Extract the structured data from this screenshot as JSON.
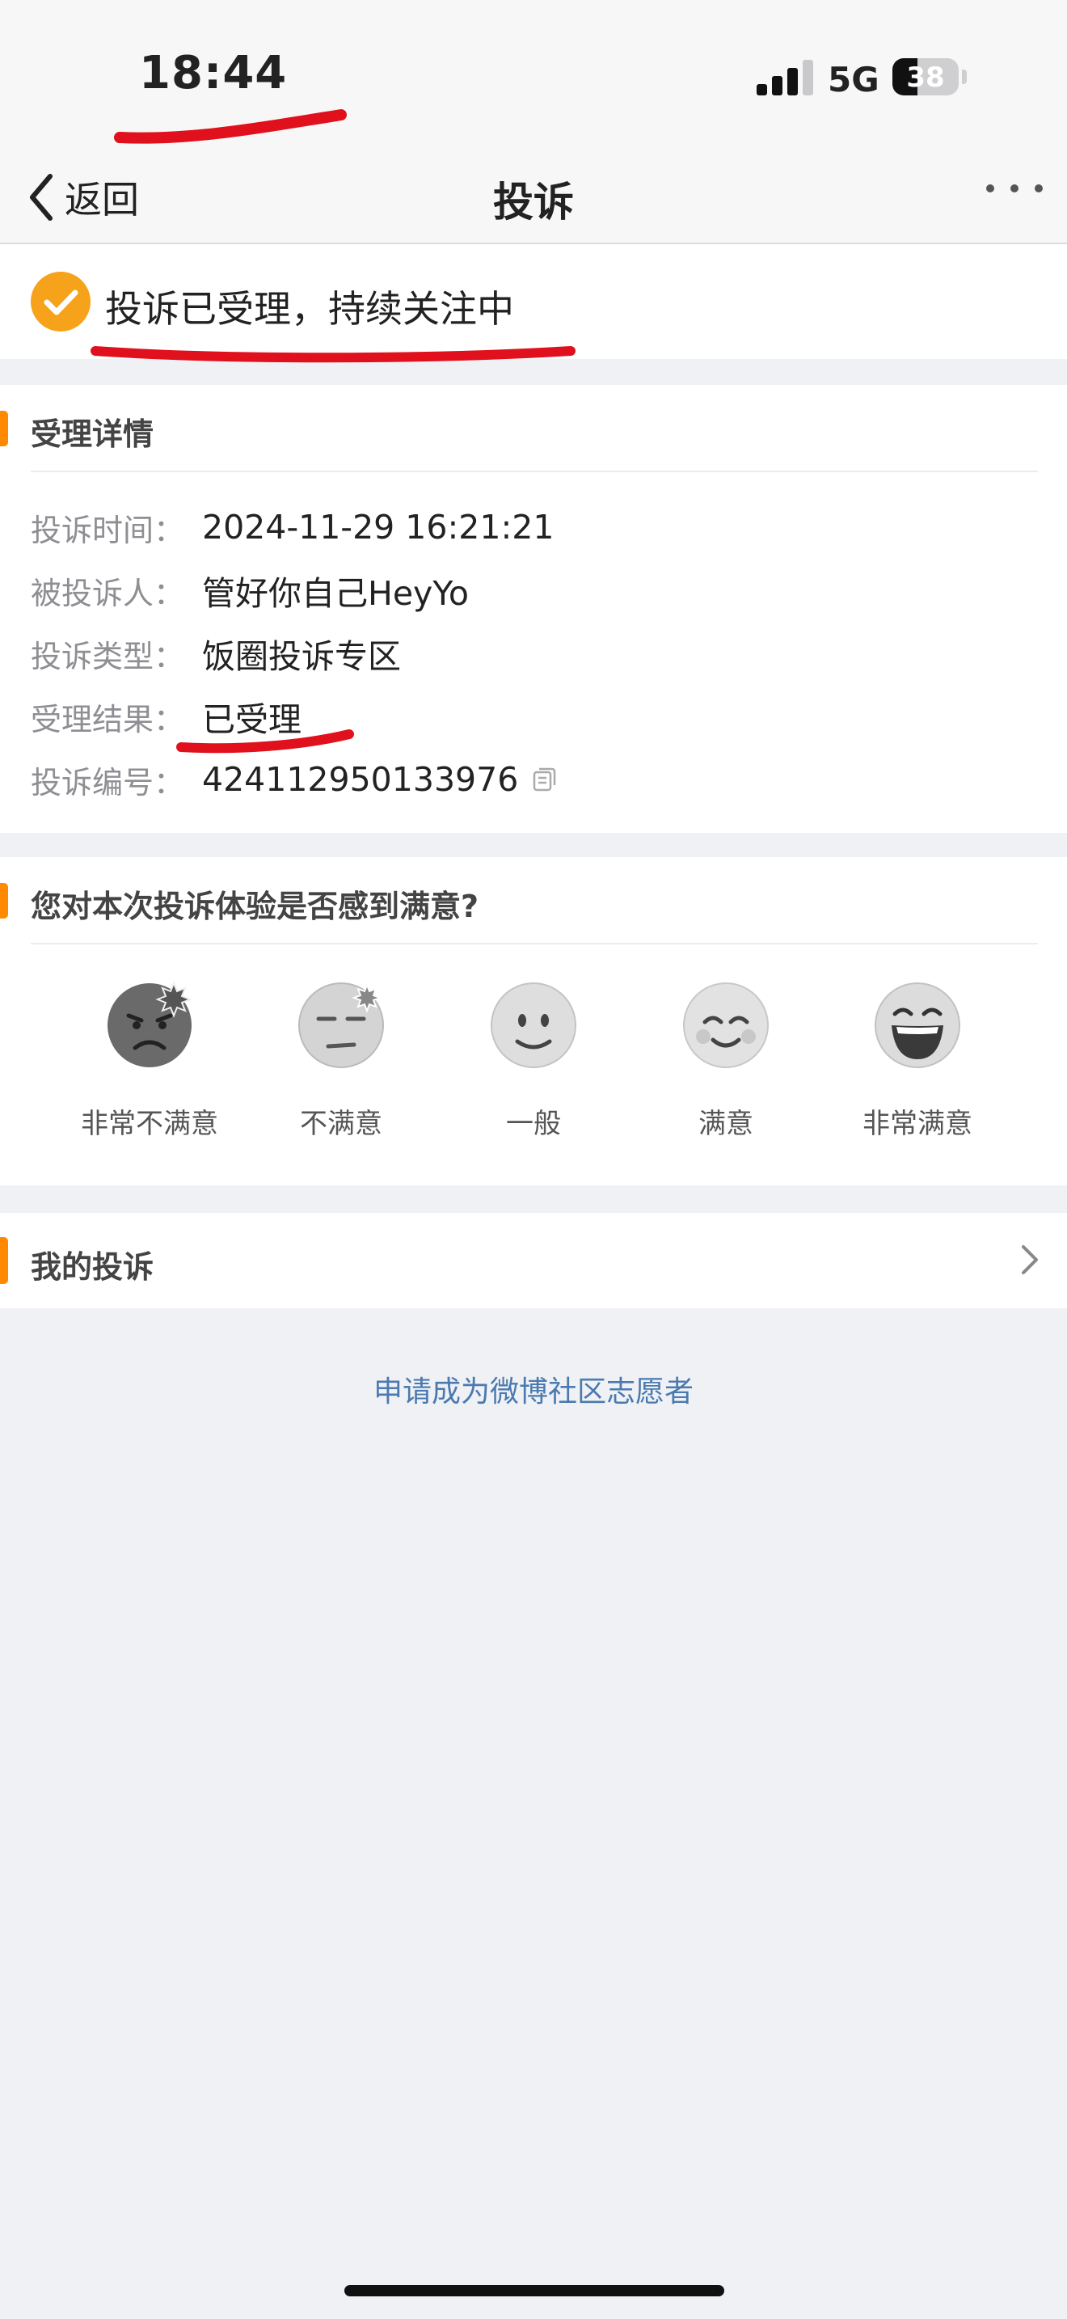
{
  "status_bar": {
    "time": "18:44",
    "network": "5G",
    "battery": "38",
    "battery_fraction": 0.38
  },
  "nav": {
    "back_label": "返回",
    "title": "投诉"
  },
  "banner": {
    "text": "投诉已受理，持续关注中"
  },
  "details": {
    "section_title": "受理详情",
    "rows": [
      {
        "key": "投诉时间：",
        "value": "2024-11-29 16:21:21"
      },
      {
        "key": "被投诉人：",
        "value": "管好你自己HeyYo"
      },
      {
        "key": "投诉类型：",
        "value": "饭圈投诉专区"
      },
      {
        "key": "受理结果：",
        "value": "已受理"
      },
      {
        "key": "投诉编号：",
        "value": "424112950133976"
      }
    ]
  },
  "survey": {
    "title": "您对本次投诉体验是否感到满意?",
    "options": [
      {
        "label": "非常不满意",
        "icon": "very-unsatisfied-icon"
      },
      {
        "label": "不满意",
        "icon": "unsatisfied-icon"
      },
      {
        "label": "一般",
        "icon": "neutral-icon"
      },
      {
        "label": "满意",
        "icon": "satisfied-icon"
      },
      {
        "label": "非常满意",
        "icon": "very-satisfied-icon"
      }
    ]
  },
  "my_complaints": {
    "label": "我的投诉"
  },
  "volunteer_link": "申请成为微博社区志愿者",
  "colors": {
    "accent": "#ff8a00",
    "check": "#f7a21b",
    "link": "#4a7ab0",
    "annotation": "#e0101c"
  }
}
